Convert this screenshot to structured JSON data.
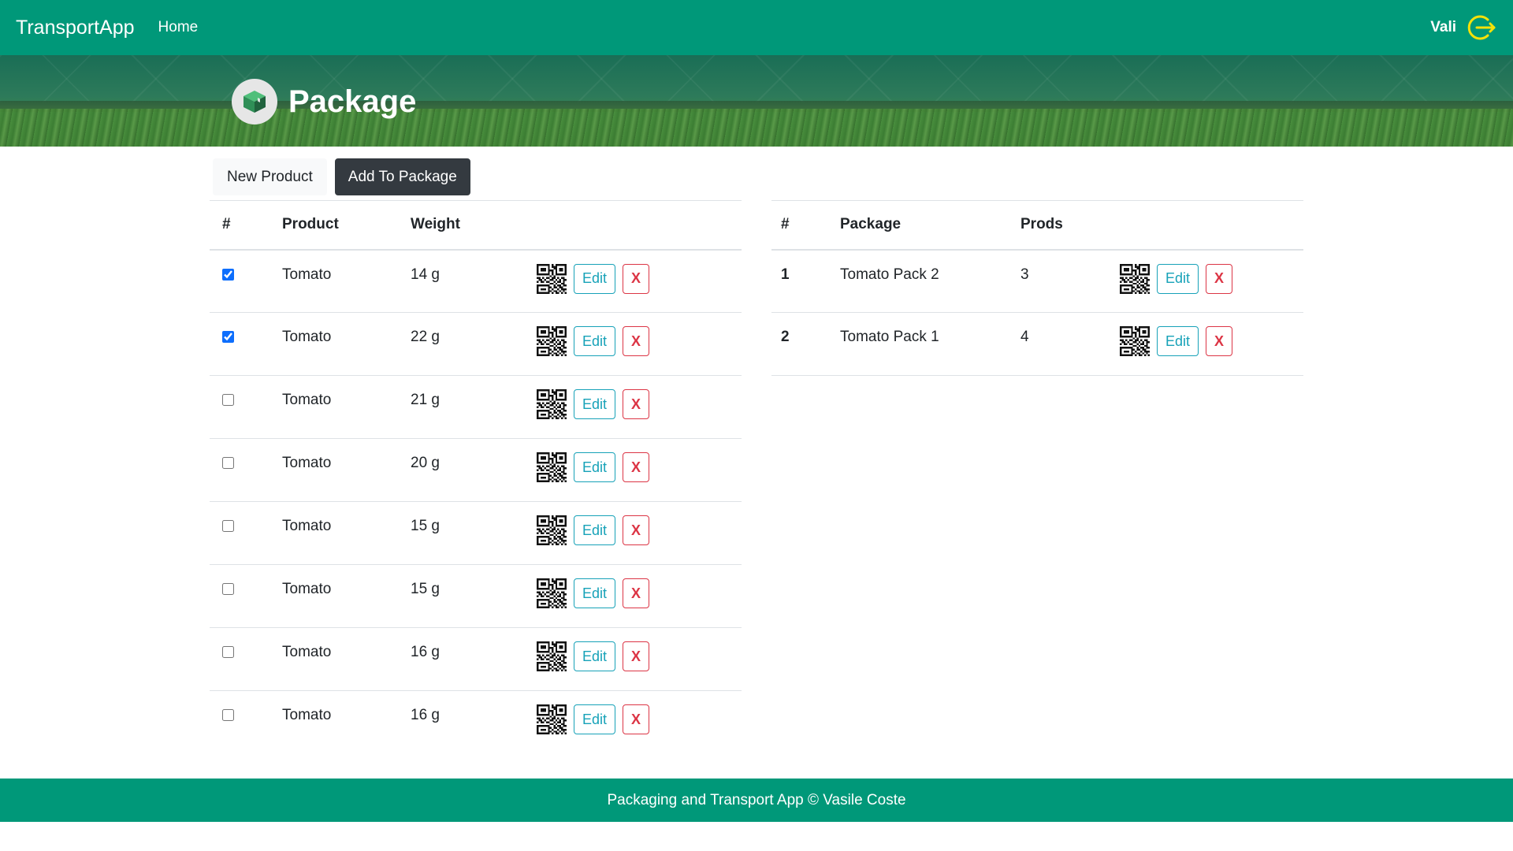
{
  "navbar": {
    "brand": "TransportApp",
    "home": "Home",
    "user": "Vali",
    "logout_icon": "logout-icon",
    "color": "#009879"
  },
  "hero": {
    "title": "Package",
    "icon": "package-icon"
  },
  "toolbar": {
    "new_product": "New Product",
    "add_to_package": "Add To Package"
  },
  "products": {
    "headers": [
      "#",
      "Product",
      "Weight"
    ],
    "rows": [
      {
        "checked": true,
        "product": "Tomato",
        "weight": "14 g",
        "edit": "Edit",
        "delete": "X"
      },
      {
        "checked": true,
        "product": "Tomato",
        "weight": "22 g",
        "edit": "Edit",
        "delete": "X"
      },
      {
        "checked": false,
        "product": "Tomato",
        "weight": "21 g",
        "edit": "Edit",
        "delete": "X"
      },
      {
        "checked": false,
        "product": "Tomato",
        "weight": "20 g",
        "edit": "Edit",
        "delete": "X"
      },
      {
        "checked": false,
        "product": "Tomato",
        "weight": "15 g",
        "edit": "Edit",
        "delete": "X"
      },
      {
        "checked": false,
        "product": "Tomato",
        "weight": "15 g",
        "edit": "Edit",
        "delete": "X"
      },
      {
        "checked": false,
        "product": "Tomato",
        "weight": "16 g",
        "edit": "Edit",
        "delete": "X"
      },
      {
        "checked": false,
        "product": "Tomato",
        "weight": "16 g",
        "edit": "Edit",
        "delete": "X"
      }
    ]
  },
  "packages": {
    "headers": [
      "#",
      "Package",
      "Prods"
    ],
    "rows": [
      {
        "num": "1",
        "package": "Tomato Pack 2",
        "prods": "3",
        "edit": "Edit",
        "delete": "X"
      },
      {
        "num": "2",
        "package": "Tomato Pack 1",
        "prods": "4",
        "edit": "Edit",
        "delete": "X"
      }
    ]
  },
  "footer": {
    "text": "Packaging and Transport App © Vasile Coste"
  }
}
